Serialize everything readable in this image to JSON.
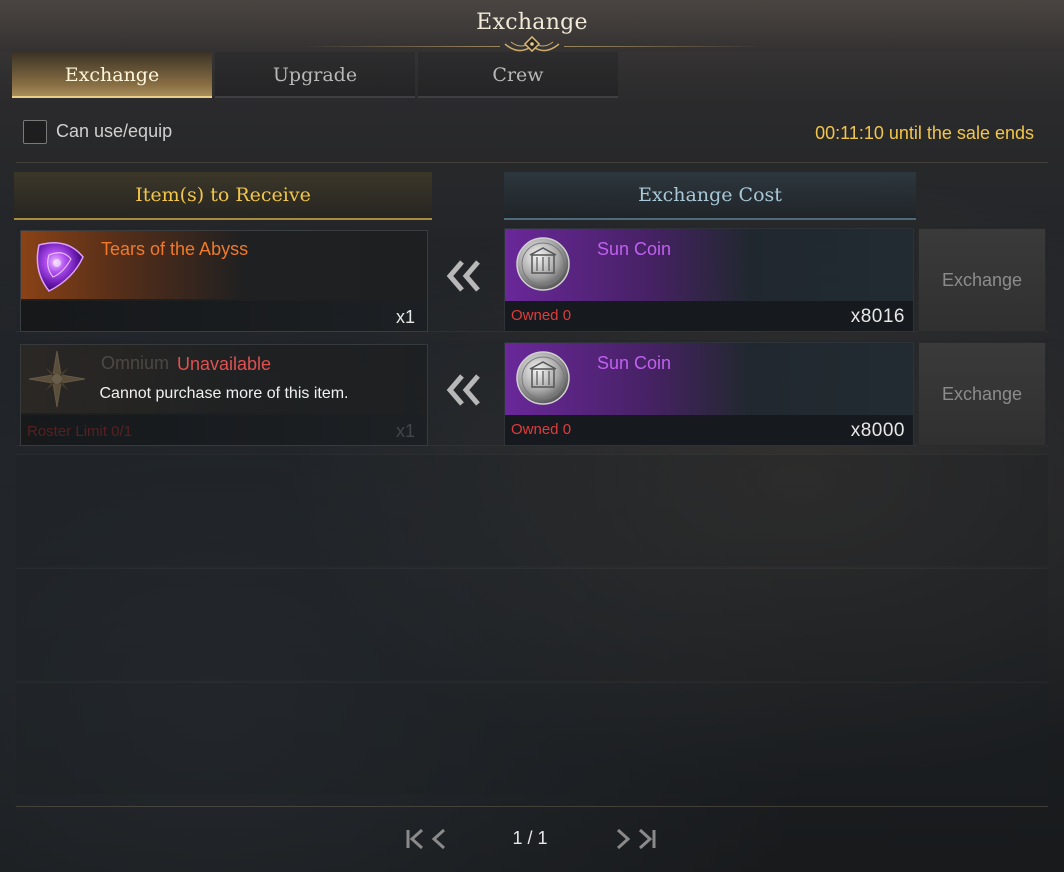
{
  "window": {
    "title": "Exchange"
  },
  "tabs": [
    {
      "label": "Exchange",
      "active": true
    },
    {
      "label": "Upgrade",
      "active": false
    },
    {
      "label": "Crew",
      "active": false
    }
  ],
  "filter": {
    "checkbox_label": "Can use/equip",
    "checked": false
  },
  "timer": "00:11:10 until the sale ends",
  "columns": {
    "receive": "Item(s) to Receive",
    "cost": "Exchange Cost"
  },
  "rows": [
    {
      "item": {
        "name": "Tears of the Abyss",
        "qty": "x1",
        "icon": "purple-gem-icon",
        "name_color": "#f07a2a"
      },
      "cost": {
        "name": "Sun Coin",
        "owned": "Owned 0",
        "qty": "x8016",
        "icon": "sun-coin-icon"
      },
      "button": "Exchange",
      "available": true
    },
    {
      "item": {
        "name": "Omnium",
        "qty": "x1",
        "icon": "star-emblem-icon",
        "limit": "Roster Limit 0/1"
      },
      "status": "Unavailable",
      "message": "Cannot purchase more of this item.",
      "cost": {
        "name": "Sun Coin",
        "owned": "Owned 0",
        "qty": "x8000",
        "icon": "sun-coin-icon"
      },
      "button": "Exchange",
      "available": false
    }
  ],
  "pagination": {
    "page": "1 / 1"
  },
  "colors": {
    "accent_gold": "#f2c64a",
    "rare_orange": "#f07a2a",
    "epic_purple": "#c060f0",
    "warning_red": "#e03c3c"
  }
}
